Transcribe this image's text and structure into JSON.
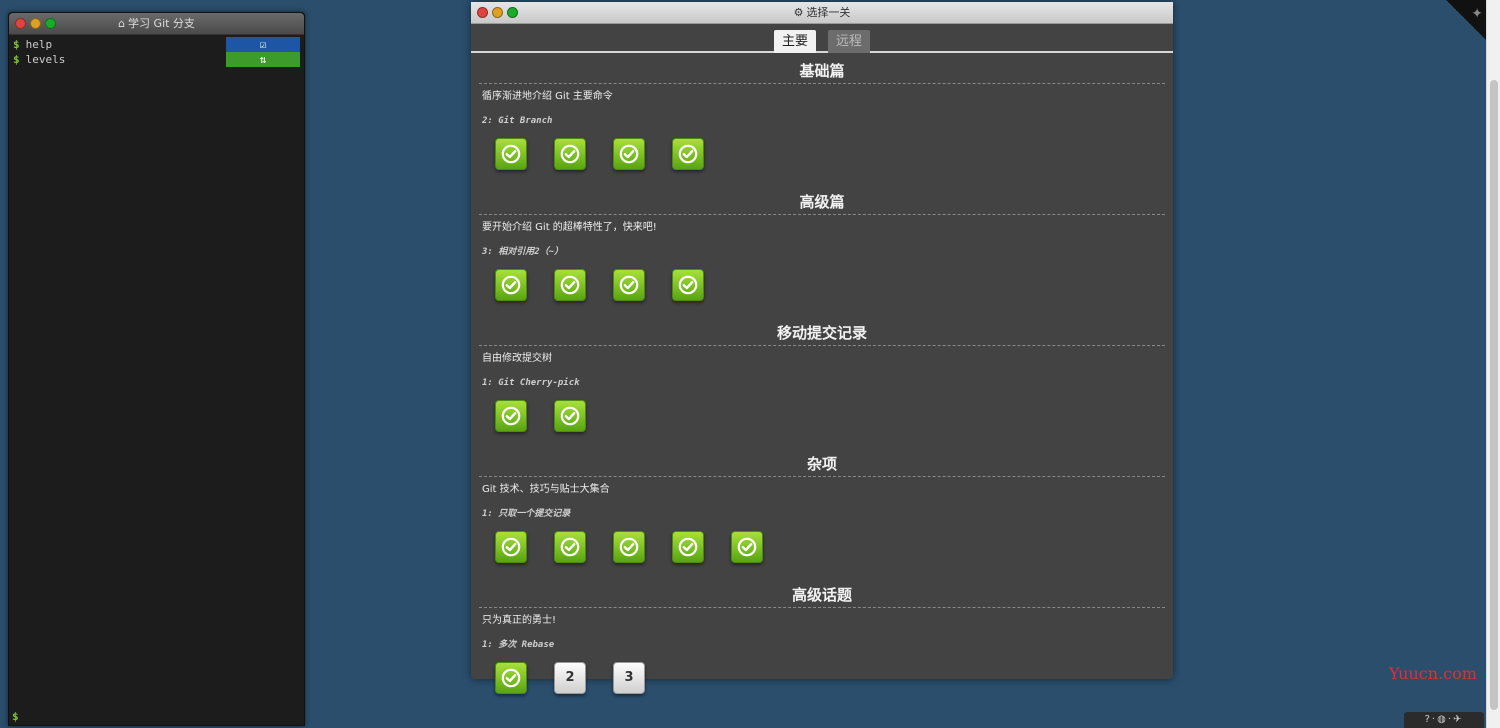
{
  "terminal": {
    "title": "学习 Git 分支",
    "commands": [
      {
        "prompt": "$",
        "text": "help",
        "badge_icon": "☑",
        "badge_color": "#1e56a6"
      },
      {
        "prompt": "$",
        "text": "levels",
        "badge_icon": "⇅",
        "badge_color": "#3c9b2b"
      }
    ],
    "bottom_prompt": "$"
  },
  "levels_window": {
    "title": "选择一关",
    "tabs": [
      {
        "label": "主要",
        "active": true
      },
      {
        "label": "远程",
        "active": false
      }
    ],
    "sequences": [
      {
        "title": "基础篇",
        "about": "循序渐进地介绍 Git 主要命令",
        "current_level": "2: Git Branch",
        "levels": [
          {
            "solved": true,
            "label": ""
          },
          {
            "solved": true,
            "label": ""
          },
          {
            "solved": true,
            "label": ""
          },
          {
            "solved": true,
            "label": ""
          }
        ]
      },
      {
        "title": "高级篇",
        "about": "要开始介绍 Git 的超棒特性了，快来吧!",
        "current_level": "3: 相对引用2（~）",
        "levels": [
          {
            "solved": true,
            "label": ""
          },
          {
            "solved": true,
            "label": ""
          },
          {
            "solved": true,
            "label": ""
          },
          {
            "solved": true,
            "label": ""
          }
        ]
      },
      {
        "title": "移动提交记录",
        "about": "自由修改提交树",
        "current_level": "1: Git Cherry-pick",
        "levels": [
          {
            "solved": true,
            "label": ""
          },
          {
            "solved": true,
            "label": ""
          }
        ]
      },
      {
        "title": "杂项",
        "about": "Git 技术、技巧与贴士大集合",
        "current_level": "1: 只取一个提交记录",
        "levels": [
          {
            "solved": true,
            "label": ""
          },
          {
            "solved": true,
            "label": ""
          },
          {
            "solved": true,
            "label": ""
          },
          {
            "solved": true,
            "label": ""
          },
          {
            "solved": true,
            "label": ""
          }
        ]
      },
      {
        "title": "高级话题",
        "about": "只为真正的勇士!",
        "current_level": "1: 多次 Rebase",
        "levels": [
          {
            "solved": true,
            "label": ""
          },
          {
            "solved": false,
            "label": "2"
          },
          {
            "solved": false,
            "label": "3"
          }
        ]
      }
    ]
  },
  "watermark": "Yuucn.com",
  "bottom_bar": {
    "icons": [
      "help-icon",
      "globe-icon",
      "twitter-icon"
    ]
  },
  "colors": {
    "background": "#2a4e6c",
    "solved_green": "#7fc72a",
    "panel": "#434343"
  }
}
